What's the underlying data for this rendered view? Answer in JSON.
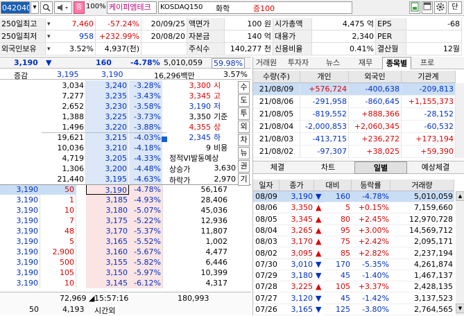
{
  "toolbar": {
    "code": "042040",
    "pct": "100%",
    "name": "케이피엠테크",
    "market": "KOSDAQ150",
    "sector": "화학",
    "margin": "증100",
    "b_down": "▾",
    "b_search": "🔍",
    "b_sound": "🔈",
    "b_pct_label": "증",
    "b_dan": "단"
  },
  "info_rows": [
    {
      "a": "250일최고",
      "b": "7,460",
      "c": "-57.24%",
      "d": "20/09/25",
      "e": "액면가",
      "f": "100 원",
      "g": "시가총액",
      "h": "4,475 억",
      "i": "EPS",
      "j": "-68"
    },
    {
      "a": "250일최저",
      "b": "958",
      "c": "+232.99%",
      "d": "20/08/20",
      "e": "자본금",
      "f": "140 억",
      "g": "대용가",
      "h": "2,340",
      "i": "PER",
      "j": ""
    },
    {
      "a": "외국인보유",
      "b": "3.52%",
      "c": "4,937(천)",
      "d": "",
      "e": "주식수",
      "f": "140,277 천",
      "g": "신용비율",
      "h": "0.41%",
      "i": "결산월",
      "j": "12월"
    }
  ],
  "price_bar": {
    "price": "3,190",
    "arrow": "▼",
    "change": "160",
    "rate": "-4.78%",
    "volume": "5,010,059",
    "vol_rate": "59.98%"
  },
  "sub_bar": {
    "label": "증감",
    "v1": "3,195",
    "v2": "3,190",
    "amount": "16,296백만",
    "pct": "3.57%"
  },
  "ask_rows": [
    {
      "qty": "3,034",
      "price": "3,240",
      "rate": "-3.28%"
    },
    {
      "qty": "7,277",
      "price": "3,235",
      "rate": "-3.43%"
    },
    {
      "qty": "2,652",
      "price": "3,230",
      "rate": "-3.58%"
    },
    {
      "qty": "1,388",
      "price": "3,225",
      "rate": "-3.73%"
    },
    {
      "qty": "1,496",
      "price": "3,220",
      "rate": "-3.88%"
    },
    {
      "qty": "19,621",
      "price": "3,215",
      "rate": "-4.03%"
    },
    {
      "qty": "10,036",
      "price": "3,210",
      "rate": "-4.18%"
    },
    {
      "qty": "4,719",
      "price": "3,205",
      "rate": "-4.33%"
    },
    {
      "qty": "1,306",
      "price": "3,200",
      "rate": "-4.48%"
    },
    {
      "qty": "21,440",
      "price": "3,195",
      "rate": "-4.63%"
    }
  ],
  "ohlc": [
    {
      "v": "3,300",
      "l": "시",
      "cls": "red"
    },
    {
      "v": "3,345",
      "l": "고",
      "cls": "red"
    },
    {
      "v": "3,190",
      "l": "저",
      "cls": "blue"
    },
    {
      "v": "3,350",
      "l": "기준",
      "cls": ""
    },
    {
      "v": "4,355",
      "l": "상",
      "cls": "red"
    },
    {
      "v": "2,345",
      "l": "하",
      "cls": "blue"
    },
    {
      "v": "9",
      "l": "비용",
      "cls": ""
    }
  ],
  "vi": {
    "title": "정적VI발동예상",
    "up_label": "상승가",
    "up": "3,630",
    "down_label": "하락가",
    "down": "2,970"
  },
  "side_buttons": [
    "수",
    "도",
    "투",
    "외",
    "차",
    "뉴",
    "권",
    "기"
  ],
  "bid_rows": [
    {
      "left": "3,190",
      "qty": "50",
      "price": "3,190",
      "rate": "-4.78%",
      "vol": "56,167"
    },
    {
      "left": "3,190",
      "qty": "1",
      "price": "3,185",
      "rate": "-4.93%",
      "vol": "28,406"
    },
    {
      "left": "3,190",
      "qty": "10",
      "price": "3,180",
      "rate": "-5.07%",
      "vol": "45,036"
    },
    {
      "left": "3,190",
      "qty": "7",
      "price": "3,175",
      "rate": "-5.22%",
      "vol": "12,936"
    },
    {
      "left": "3,190",
      "qty": "48",
      "price": "3,170",
      "rate": "-5.37%",
      "vol": "11,807"
    },
    {
      "left": "3,190",
      "qty": "5",
      "price": "3,165",
      "rate": "-5.52%",
      "vol": "1,002"
    },
    {
      "left": "3,190",
      "qty": "2,900",
      "price": "3,160",
      "rate": "-5.67%",
      "vol": "4,477"
    },
    {
      "left": "3,190",
      "qty": "500",
      "price": "3,155",
      "rate": "-5.82%",
      "vol": "6,446"
    },
    {
      "left": "3,190",
      "qty": "105",
      "price": "3,150",
      "rate": "-5.97%",
      "vol": "10,399"
    },
    {
      "left": "3,190",
      "qty": "10",
      "price": "3,145",
      "rate": "-6.12%",
      "vol": "4,317"
    }
  ],
  "footer": {
    "ask_total": "72,969",
    "time": "15:57:16",
    "bid_total": "180,993",
    "f_left": "50",
    "f_qty": "4,193",
    "f_label": "시간외"
  },
  "right_tabs": [
    "거래원",
    "투자자",
    "뉴스",
    "재무",
    "종목별",
    "프로"
  ],
  "investor": {
    "headers": [
      "수량(주)",
      "개인",
      "외국인",
      "기관계"
    ],
    "rows": [
      {
        "d": "21/08/09",
        "a": "+576,724",
        "b": "-400,638",
        "c": "-209,813"
      },
      {
        "d": "21/08/06",
        "a": "-291,958",
        "b": "-860,645",
        "c": "+1,155,373"
      },
      {
        "d": "21/08/05",
        "a": "-819,552",
        "b": "+888,366",
        "c": "-28,152"
      },
      {
        "d": "21/08/04",
        "a": "-2,000,853",
        "b": "+2,060,345",
        "c": "-60,532"
      },
      {
        "d": "21/08/03",
        "a": "-413,715",
        "b": "+236,272",
        "c": "+173,194"
      },
      {
        "d": "21/08/02",
        "a": "-97,307",
        "b": "+38,025",
        "c": "+59,390"
      }
    ]
  },
  "lower_tabs": [
    "체결",
    "차트",
    "일별",
    "예상체결"
  ],
  "daily": {
    "headers": [
      "일자",
      "종가",
      "대비",
      "등락률",
      "거래량"
    ],
    "rows": [
      {
        "d": "08/09",
        "p": "3,190",
        "s": "▼",
        "ch": "160",
        "r": "-4.78%",
        "v": "5,010,059",
        "dir": "down"
      },
      {
        "d": "08/06",
        "p": "3,350",
        "s": "▲",
        "ch": "5",
        "r": "+0.15%",
        "v": "7,159,660",
        "dir": "up"
      },
      {
        "d": "08/05",
        "p": "3,345",
        "s": "▲",
        "ch": "80",
        "r": "+2.45%",
        "v": "12,970,728",
        "dir": "up"
      },
      {
        "d": "08/04",
        "p": "3,265",
        "s": "▲",
        "ch": "95",
        "r": "+3.00%",
        "v": "14,569,712",
        "dir": "up"
      },
      {
        "d": "08/03",
        "p": "3,170",
        "s": "▲",
        "ch": "75",
        "r": "+2.42%",
        "v": "2,095,171",
        "dir": "up"
      },
      {
        "d": "08/02",
        "p": "3,095",
        "s": "▲",
        "ch": "85",
        "r": "+2.82%",
        "v": "2,237,194",
        "dir": "up"
      },
      {
        "d": "07/30",
        "p": "3,010",
        "s": "▼",
        "ch": "170",
        "r": "-5.35%",
        "v": "4,261,874",
        "dir": "down"
      },
      {
        "d": "07/29",
        "p": "3,180",
        "s": "▼",
        "ch": "45",
        "r": "-1.40%",
        "v": "1,467,137",
        "dir": "down"
      },
      {
        "d": "07/28",
        "p": "3,225",
        "s": "▲",
        "ch": "105",
        "r": "+3.37%",
        "v": "2,428,135",
        "dir": "up"
      },
      {
        "d": "07/27",
        "p": "3,120",
        "s": "▼",
        "ch": "45",
        "r": "-1.42%",
        "v": "3,137,523",
        "dir": "down"
      },
      {
        "d": "07/26",
        "p": "3,165",
        "s": "▼",
        "ch": "125",
        "r": "-3.80%",
        "v": "2,764,565",
        "dir": "down"
      }
    ]
  },
  "colors": {
    "up": "#e00000",
    "down": "#0030c8",
    "ask_bg": "#dce8f8",
    "bid_bg": "#fbe4e4",
    "selected_row": "#c9ddf5"
  }
}
